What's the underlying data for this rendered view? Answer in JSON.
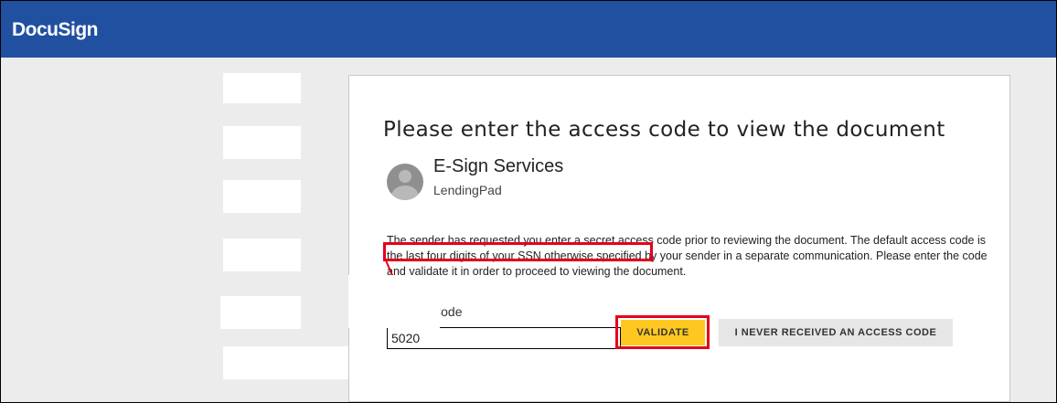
{
  "header": {
    "logo": "DocuSign",
    "color": "#2150a0"
  },
  "card": {
    "title": "Please enter the access code to view the document",
    "sender": {
      "name": "E-Sign Services",
      "organization": "LendingPad",
      "avatar_icon": "user-avatar-icon"
    },
    "message": "The sender has requested you enter a secret access code prior to reviewing the document. The default access code is the last four digits of your SSN otherwise specified by your sender in a separate communication. Please enter the code and validate it in order to proceed to viewing the document.",
    "access_code_label": "Access Code",
    "access_code_value": "5020",
    "validate_label": "VALIDATE",
    "never_received_label": "I NEVER RECEIVED AN ACCESS CODE"
  },
  "colors": {
    "validate_button": "#ffc820",
    "annotation": "#e3001b",
    "background": "#ececec"
  }
}
